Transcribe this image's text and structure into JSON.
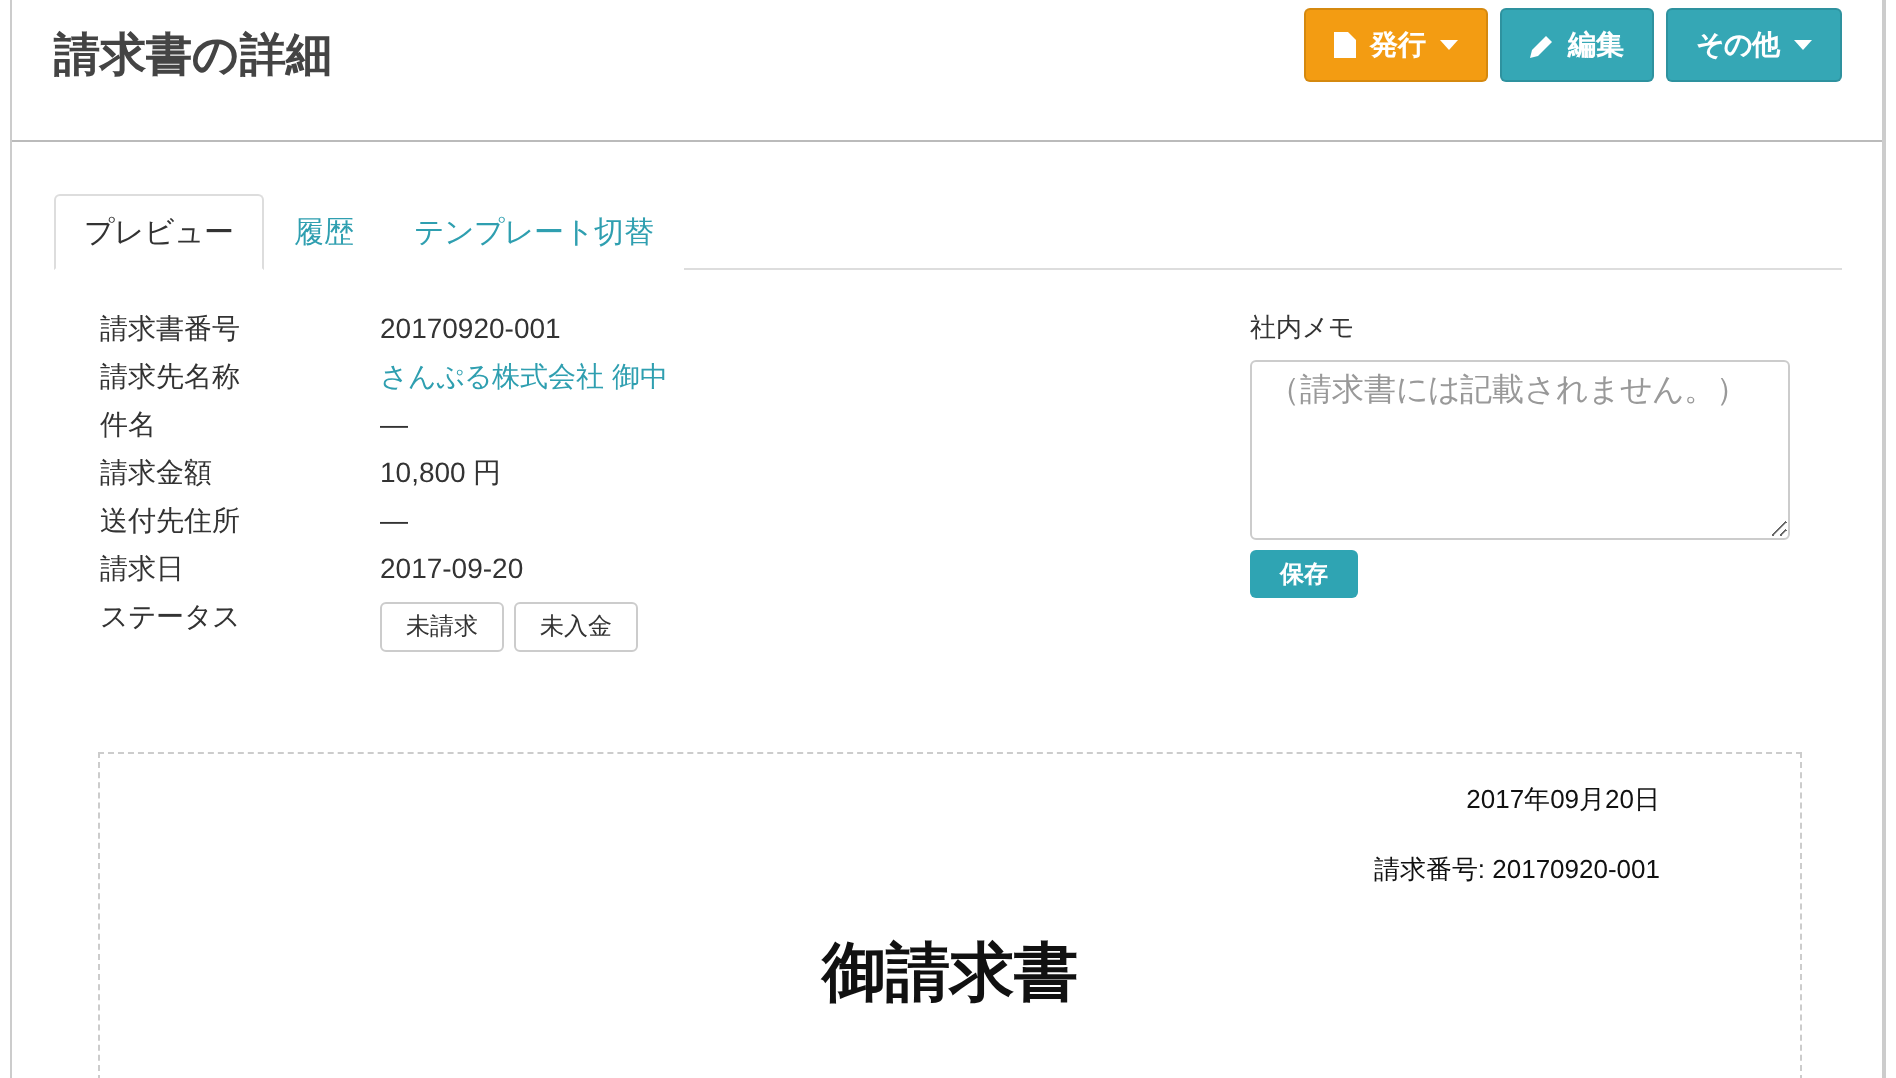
{
  "page": {
    "title": "請求書の詳細"
  },
  "actions": [
    {
      "label": "発行",
      "color": "#f39c12",
      "kind": "dropdown"
    },
    {
      "label": "編集",
      "color": "#35a7b5",
      "kind": "plain"
    },
    {
      "label": "その他",
      "color": "#35a7b5",
      "kind": "dropdown"
    }
  ],
  "tabs": [
    {
      "label": "プレビュー",
      "selected": true
    },
    {
      "label": "履歴",
      "selected": false
    },
    {
      "label": "テンプレート切替",
      "selected": false
    }
  ],
  "details": [
    {
      "label": "請求書番号",
      "kind": "text",
      "value": "20170920-001"
    },
    {
      "label": "請求先名称",
      "kind": "link",
      "value": "さんぷる株式会社 御中"
    },
    {
      "label": "件名",
      "kind": "text",
      "value": "—"
    },
    {
      "label": "請求金額",
      "kind": "text",
      "value": "10,800 円"
    },
    {
      "label": "送付先住所",
      "kind": "text",
      "value": "—"
    },
    {
      "label": "請求日",
      "kind": "text",
      "value": "2017-09-20"
    },
    {
      "label": "ステータス",
      "kind": "badges",
      "badges": [
        "未請求",
        "未入金"
      ]
    }
  ],
  "memo": {
    "label": "社内メモ",
    "placeholder": "（請求書には記載されません。）",
    "save_button": "保存"
  },
  "preview": {
    "date": "2017年09月20日",
    "number": "請求番号: 20170920-001",
    "title": "御請求書"
  }
}
